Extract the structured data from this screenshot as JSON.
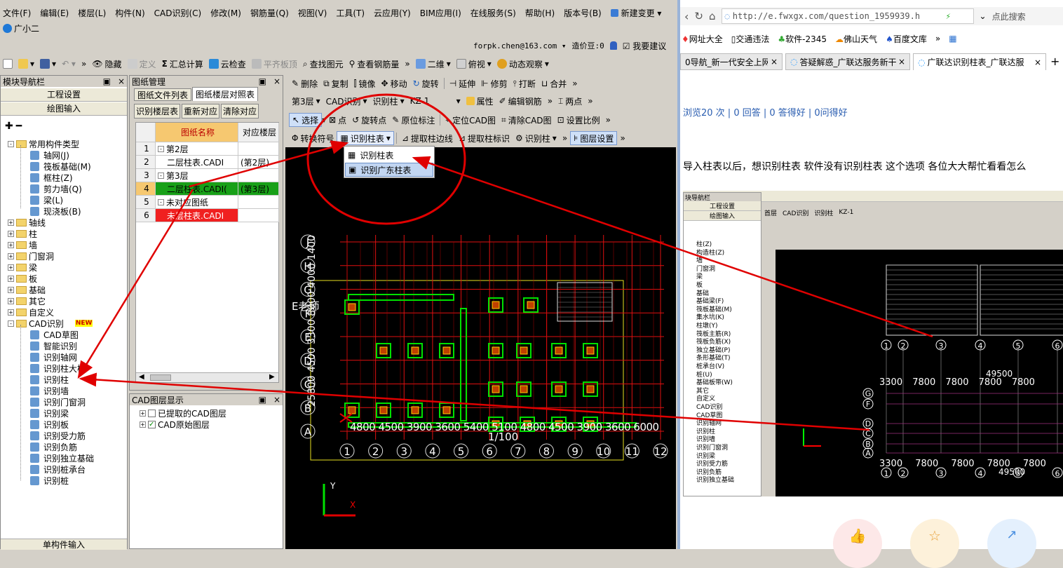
{
  "app": {
    "title": "广小二",
    "menu": [
      "文件(F)",
      "编辑(E)",
      "楼层(L)",
      "构件(N)",
      "CAD识别(C)",
      "修改(M)",
      "钢筋量(Q)",
      "视图(V)",
      "工具(T)",
      "云应用(Y)",
      "BIM应用(I)",
      "在线服务(S)",
      "帮助(H)",
      "版本号(B)",
      "新建变更"
    ],
    "user": "forpk.chen@163.com",
    "cost": "造价豆:0",
    "suggest": "我要建议",
    "toolbar1": [
      "隐藏",
      "定义",
      "汇总计算",
      "云检查",
      "平齐板顶",
      "查找图元",
      "查看钢筋量"
    ],
    "view2d": "二维",
    "view_top": "俯视",
    "dynamic": "动态观察",
    "toolbar_edit": [
      "删除",
      "复制",
      "镜像",
      "移动",
      "旋转",
      "延伸",
      "修剪",
      "打断",
      "合并"
    ],
    "floor": "第3层",
    "cad_sel": "CAD识别",
    "col_sel": "识别柱",
    "kz": "KZ-1",
    "attr": "属性",
    "edit_rebar": "编辑钢筋",
    "two_points": "两点",
    "select": "选择",
    "point": "点",
    "rot_point": "旋转点",
    "orig_mark": "原位标注",
    "locate": "定位CAD图",
    "clear_cad": "清除CAD图",
    "set_scale": "设置比例",
    "conv_sym": "转换符号",
    "recog_table": "识别柱表",
    "extract_edge": "提取柱边线",
    "extract_mark": "提取柱标识",
    "recog_col": "识别柱",
    "layer_set": "图层设置",
    "dropdown": [
      "识别柱表",
      "识别广东柱表"
    ]
  },
  "nav": {
    "title": "模块导航栏",
    "pin": "▣",
    "close": "×",
    "eng": "工程设置",
    "draw": "绘图输入",
    "tree": [
      {
        "t": "常用构件类型",
        "lvl": 1,
        "exp": "-"
      },
      {
        "t": "轴网(J)",
        "lvl": 2
      },
      {
        "t": "筏板基础(M)",
        "lvl": 2
      },
      {
        "t": "框柱(Z)",
        "lvl": 2
      },
      {
        "t": "剪力墙(Q)",
        "lvl": 2
      },
      {
        "t": "梁(L)",
        "lvl": 2
      },
      {
        "t": "现浇板(B)",
        "lvl": 2
      },
      {
        "t": "轴线",
        "lvl": 1,
        "exp": "+"
      },
      {
        "t": "柱",
        "lvl": 1,
        "exp": "+"
      },
      {
        "t": "墙",
        "lvl": 1,
        "exp": "+"
      },
      {
        "t": "门窗洞",
        "lvl": 1,
        "exp": "+"
      },
      {
        "t": "梁",
        "lvl": 1,
        "exp": "+"
      },
      {
        "t": "板",
        "lvl": 1,
        "exp": "+"
      },
      {
        "t": "基础",
        "lvl": 1,
        "exp": "+"
      },
      {
        "t": "其它",
        "lvl": 1,
        "exp": "+"
      },
      {
        "t": "自定义",
        "lvl": 1,
        "exp": "+"
      },
      {
        "t": "CAD识别",
        "lvl": 1,
        "exp": "-",
        "new": "NEW"
      },
      {
        "t": "CAD草图",
        "lvl": 2
      },
      {
        "t": "智能识别",
        "lvl": 2
      },
      {
        "t": "识别轴网",
        "lvl": 2
      },
      {
        "t": "识别柱大样",
        "lvl": 2
      },
      {
        "t": "识别柱",
        "lvl": 2
      },
      {
        "t": "识别墙",
        "lvl": 2
      },
      {
        "t": "识别门窗洞",
        "lvl": 2
      },
      {
        "t": "识别梁",
        "lvl": 2
      },
      {
        "t": "识别板",
        "lvl": 2
      },
      {
        "t": "识别受力筋",
        "lvl": 2
      },
      {
        "t": "识别负筋",
        "lvl": 2
      },
      {
        "t": "识别独立基础",
        "lvl": 2
      },
      {
        "t": "识别桩承台",
        "lvl": 2
      },
      {
        "t": "识别桩",
        "lvl": 2
      }
    ],
    "bottom": "单构件输入"
  },
  "drawing": {
    "title": "图纸管理",
    "tab1": "图纸文件列表",
    "tab2": "图纸楼层对照表",
    "b1": "识别楼层表",
    "b2": "重新对应",
    "b3": "清除对应",
    "col_name": "图纸名称",
    "col_floor": "对应楼层",
    "rows": [
      {
        "n": "1",
        "name": "第2层",
        "floor": "",
        "pm": "-"
      },
      {
        "n": "2",
        "name": "二层柱表.CADI",
        "floor": "(第2层)"
      },
      {
        "n": "3",
        "name": "第3层",
        "floor": "",
        "pm": "-"
      },
      {
        "n": "4",
        "name": "二层柱表.CADI(",
        "floor": "(第3层)",
        "hl": "green"
      },
      {
        "n": "5",
        "name": "未对应图纸",
        "floor": "",
        "pm": "-"
      },
      {
        "n": "6",
        "name": "未层柱表.CADI",
        "floor": "",
        "hl": "red"
      }
    ]
  },
  "layers": {
    "title": "CAD图层显示",
    "items": [
      "已提取的CAD图层",
      "CAD原始图层"
    ]
  },
  "cad": {
    "rows": [
      "J",
      "H",
      "G",
      "F",
      "E",
      "D",
      "C",
      "B",
      "A"
    ],
    "cols": [
      "1",
      "2",
      "3",
      "4",
      "5",
      "6",
      "7",
      "8",
      "9",
      "10",
      "11",
      "12"
    ],
    "dims": "4800 4500 3900 3600 5400 5100 4800 4500 3900 3600 6000",
    "teacher": "E老师",
    "scale": "1/100",
    "vert_text": "25800 4500 3300 8000 4000 1400 2400",
    "ax_y": "Y",
    "ax_x": "X"
  },
  "browser": {
    "url": "http://e.fwxgx.com/question_1959939.h",
    "search": "点此搜索",
    "bookmarks": [
      "网址大全",
      "交通违法",
      "软件-2345",
      "佛山天气",
      "百度文库"
    ],
    "tabs": [
      "0导航_新一代安全上网",
      "答疑解惑_广联达服务新干",
      "广联达识别柱表_广联达服"
    ],
    "stats": "浏览20 次 | 0 回答 | 0 答得好 | 0问得好",
    "question": "导入柱表以后，想识别柱表 软件没有识别柱表 这个选项 各位大大帮忙看看怎么",
    "inner": {
      "nav": "块导航栏",
      "eng": "工程设置",
      "draw": "绘图输入",
      "floor": "首层",
      "cad": "CAD识别",
      "col": "识别柱",
      "kz": "KZ-1",
      "tree": [
        "柱(Z)",
        "构造柱(Z)",
        "墙",
        "门窗洞",
        "梁",
        "板",
        "基础",
        "基础梁(F)",
        "筏板基础(M)",
        "集水坑(K)",
        "柱墩(Y)",
        "筏板主筋(R)",
        "筏板负筋(X)",
        "独立基础(P)",
        "条形基础(T)",
        "桩承台(V)",
        "桩(U)",
        "基础板带(W)",
        "其它",
        "自定义",
        "CAD识别",
        "CAD草图",
        "识别轴网",
        "识别柱",
        "识别墙",
        "识别门窗洞",
        "识别梁",
        "识别受力筋",
        "识别负筋",
        "识别独立基础"
      ],
      "dims1": "3300 7800 7800 7800 7800",
      "dims2": "3300 7800 7800 7800 7800",
      "total1": "49500",
      "total2": "49500",
      "cols": [
        "1",
        "2",
        "3",
        "4",
        "5",
        "6"
      ],
      "rows": [
        "G",
        "F",
        "D",
        "C",
        "B",
        "A"
      ]
    }
  },
  "colors": {
    "red": "#e00000",
    "cad_bg": "#000000",
    "grid": "#e01010",
    "green": "#00d000"
  }
}
